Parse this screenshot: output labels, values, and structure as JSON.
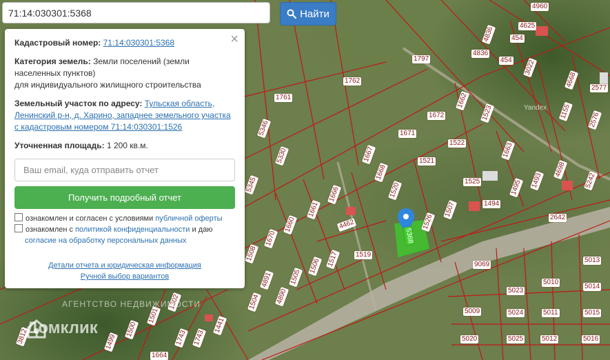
{
  "search": {
    "value": "71:14:030301:5368",
    "button_label": "Найти"
  },
  "panel": {
    "cadastral_label": "Кадастровый номер:",
    "cadastral_value": "71:14:030301:5368",
    "category_label": "Категория земель:",
    "category_value_1": "Земли поселений (земли",
    "category_value_2": "населенных пунктов)",
    "category_value_3": "для индивидуального жилищного строительства",
    "address_label": "Земельный участок по адресу:",
    "address_line_1": "Тульская область,",
    "address_line_2": "Ленинский р-н, д. Харино, западнее земельного участка",
    "address_line_3": "с кадастровым номером 71:14:030301:1526",
    "area_label": "Уточненная площадь:",
    "area_value": "1 200 кв.м.",
    "email_placeholder": "Ваш email, куда отправить отчет",
    "report_button": "Получить подробный отчет",
    "consent1_text": "ознакомлен и согласен с условиями",
    "consent1_link": "публичной оферты",
    "consent2_text": "ознакомлен с",
    "consent2_link": "политикой конфиденциальности",
    "consent2_text_b": "и даю",
    "consent2_link_b": "согласие на обработку персональных данных",
    "details_link": "Детали отчета и юридическая информация",
    "manual_link": "Ручной выбор вариантов",
    "close_glyph": "×"
  },
  "map": {
    "yandex": "Yandex",
    "agency_watermark": "АГЕНТСТВО НЕДВИЖИМОСТИ",
    "domklik_watermark": "Домклик",
    "selected_parcel_label": "5368",
    "parcel_labels": [
      "4960",
      "4625",
      "4836",
      "454",
      "4836",
      "454",
      "3022",
      "1797",
      "1762",
      "4668",
      "2577",
      "1761",
      "1662",
      "1523",
      "1155",
      "2576",
      "5346",
      "1672",
      "1671",
      "1663",
      "1522",
      "5330",
      "1667",
      "1521",
      "4698",
      "1493",
      "5242",
      "1668",
      "1525",
      "1495",
      "5345",
      "1666",
      "1520",
      "1494",
      "1661",
      "1507",
      "2642",
      "1526",
      "4462",
      "1660",
      "1670",
      "1519",
      "1508",
      "1517",
      "1506",
      "9069",
      "5013",
      "4891",
      "1505",
      "4890",
      "1504",
      "5010",
      "5014",
      "5023",
      "1302",
      "5009",
      "5024",
      "5011",
      "5015",
      "1501",
      "1500",
      "1441",
      "1743",
      "1743",
      "1499",
      "3812",
      "5020",
      "5025",
      "5012",
      "5016",
      "1664"
    ]
  }
}
